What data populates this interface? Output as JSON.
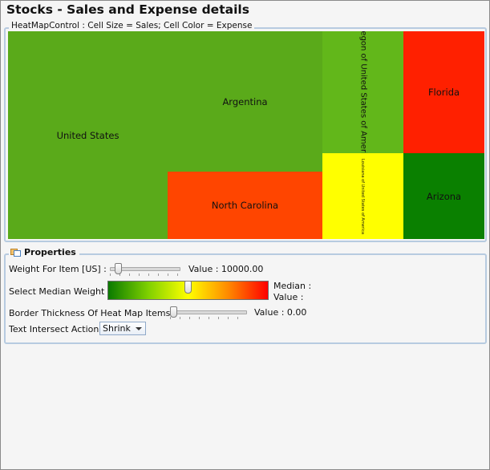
{
  "title": "Stocks - Sales and Expense details",
  "heatmap": {
    "group_label": "HeatMapControl : Cell Size = Sales; Cell Color = Expense",
    "cells": [
      {
        "label": "United States",
        "color": "#5aaa1a"
      },
      {
        "label": "Argentina",
        "color": "#5aaa1a"
      },
      {
        "label": "North Carolina",
        "color": "#ff4500"
      },
      {
        "label": "Oregon of United States of America",
        "color": "#62b71a"
      },
      {
        "label": "Louisiana of United States of America",
        "color": "#ffff00"
      },
      {
        "label": "Florida",
        "color": "#ff2000"
      },
      {
        "label": "Arizona",
        "color": "#0a8000"
      }
    ]
  },
  "properties": {
    "header": "Properties",
    "weight_label": "Weight For Item [US] :",
    "weight_value_label": "Value : 10000.00",
    "weight_level": 0.08,
    "median_label": "Select Median Weight :",
    "median_value_label_1": "Median :",
    "median_value_label_2": "Value :",
    "median_level": 0.5,
    "border_label": "Border Thickness Of Heat Map Items :",
    "border_value_label": "Value : 0.00",
    "border_level": 0.0,
    "text_action_label": "Text Intersect Action:",
    "text_action_value": "Shrink"
  }
}
